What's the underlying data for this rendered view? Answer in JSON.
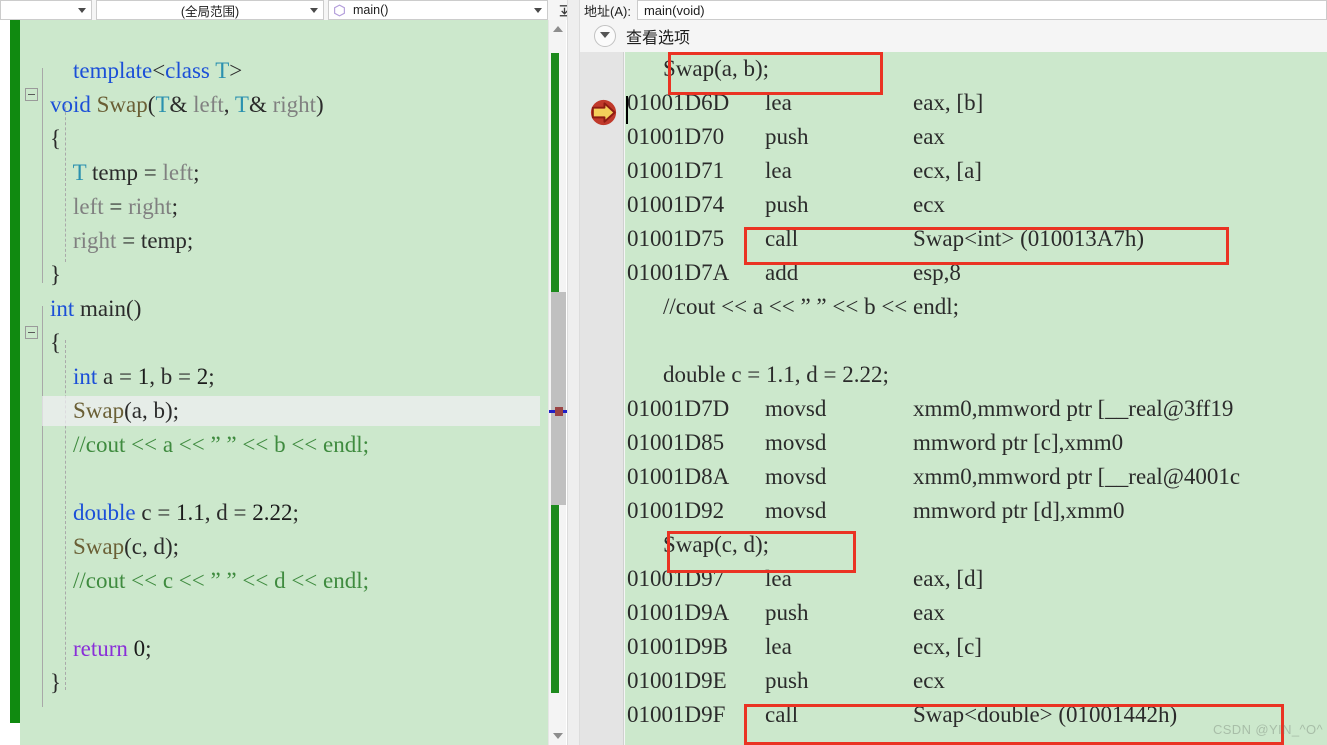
{
  "nav": {
    "scope_combo": "(全局范围)",
    "member_combo": "main()",
    "member_icon": "method-icon",
    "first_combo": "",
    "expand_button_icon": "collapse-all-icon"
  },
  "right_panel": {
    "address_label": "地址(A):",
    "address_label_plain": "地址",
    "address_accel": "A",
    "address_value": "main(void)",
    "view_options_label": "查看选项",
    "view_options_icon": "chevron-down-icon"
  },
  "editor": {
    "lines": [
      {
        "indent": 0,
        "fold": false,
        "text": "",
        "tokens": []
      },
      {
        "indent": 0,
        "fold": false,
        "tokens": [
          {
            "t": "    ",
            "c": "pln"
          },
          {
            "t": "template",
            "c": "kw"
          },
          {
            "t": "<",
            "c": "pln"
          },
          {
            "t": "class",
            "c": "kw"
          },
          {
            "t": " ",
            "c": "pln"
          },
          {
            "t": "T",
            "c": "typ"
          },
          {
            "t": ">",
            "c": "pln"
          }
        ]
      },
      {
        "indent": 0,
        "fold": true,
        "tokens": [
          {
            "t": "void",
            "c": "kw"
          },
          {
            "t": " ",
            "c": "pln"
          },
          {
            "t": "Swap",
            "c": "fn"
          },
          {
            "t": "(",
            "c": "pln"
          },
          {
            "t": "T",
            "c": "typ"
          },
          {
            "t": "& ",
            "c": "pln"
          },
          {
            "t": "left",
            "c": "gry"
          },
          {
            "t": ", ",
            "c": "pln"
          },
          {
            "t": "T",
            "c": "typ"
          },
          {
            "t": "& ",
            "c": "pln"
          },
          {
            "t": "right",
            "c": "gry"
          },
          {
            "t": ")",
            "c": "pln"
          }
        ]
      },
      {
        "indent": 0,
        "fold": false,
        "tokens": [
          {
            "t": "{",
            "c": "pln"
          }
        ]
      },
      {
        "indent": 0,
        "fold": false,
        "tokens": [
          {
            "t": "    ",
            "c": "pln"
          },
          {
            "t": "T",
            "c": "typ"
          },
          {
            "t": " temp ",
            "c": "pln"
          },
          {
            "t": "= ",
            "c": "pln"
          },
          {
            "t": "left",
            "c": "gry"
          },
          {
            "t": ";",
            "c": "pln"
          }
        ]
      },
      {
        "indent": 0,
        "fold": false,
        "tokens": [
          {
            "t": "    ",
            "c": "pln"
          },
          {
            "t": "left",
            "c": "gry"
          },
          {
            "t": " = ",
            "c": "pln"
          },
          {
            "t": "right",
            "c": "gry"
          },
          {
            "t": ";",
            "c": "pln"
          }
        ]
      },
      {
        "indent": 0,
        "fold": false,
        "tokens": [
          {
            "t": "    ",
            "c": "pln"
          },
          {
            "t": "right",
            "c": "gry"
          },
          {
            "t": " = temp;",
            "c": "pln"
          }
        ]
      },
      {
        "indent": 0,
        "fold": false,
        "tokens": [
          {
            "t": "}",
            "c": "pln"
          }
        ]
      },
      {
        "indent": 0,
        "fold": true,
        "tokens": [
          {
            "t": "int",
            "c": "kw"
          },
          {
            "t": " ",
            "c": "pln"
          },
          {
            "t": "main",
            "c": "pln"
          },
          {
            "t": "()",
            "c": "pln"
          }
        ]
      },
      {
        "indent": 0,
        "fold": false,
        "tokens": [
          {
            "t": "{",
            "c": "pln"
          }
        ]
      },
      {
        "indent": 0,
        "fold": false,
        "tokens": [
          {
            "t": "    ",
            "c": "pln"
          },
          {
            "t": "int",
            "c": "kw"
          },
          {
            "t": " a = ",
            "c": "pln"
          },
          {
            "t": "1",
            "c": "num"
          },
          {
            "t": ", b = ",
            "c": "pln"
          },
          {
            "t": "2",
            "c": "num"
          },
          {
            "t": ";",
            "c": "pln"
          }
        ]
      },
      {
        "indent": 0,
        "fold": false,
        "highlight": true,
        "tokens": [
          {
            "t": "    ",
            "c": "pln"
          },
          {
            "t": "Swap",
            "c": "fn"
          },
          {
            "t": "(a, b);",
            "c": "pln"
          }
        ]
      },
      {
        "indent": 0,
        "fold": false,
        "tokens": [
          {
            "t": "    ",
            "c": "pln"
          },
          {
            "t": "//cout << a << ” ” << b << endl;",
            "c": "com"
          }
        ]
      },
      {
        "indent": 0,
        "fold": false,
        "tokens": []
      },
      {
        "indent": 0,
        "fold": false,
        "tokens": [
          {
            "t": "    ",
            "c": "pln"
          },
          {
            "t": "double",
            "c": "kw"
          },
          {
            "t": " c = ",
            "c": "pln"
          },
          {
            "t": "1.1",
            "c": "num"
          },
          {
            "t": ", d = ",
            "c": "pln"
          },
          {
            "t": "2.22",
            "c": "num"
          },
          {
            "t": ";",
            "c": "pln"
          }
        ]
      },
      {
        "indent": 0,
        "fold": false,
        "tokens": [
          {
            "t": "    ",
            "c": "pln"
          },
          {
            "t": "Swap",
            "c": "fn"
          },
          {
            "t": "(c, d);",
            "c": "pln"
          }
        ]
      },
      {
        "indent": 0,
        "fold": false,
        "tokens": [
          {
            "t": "    ",
            "c": "pln"
          },
          {
            "t": "//cout << c << ” ” << d << endl;",
            "c": "com"
          }
        ]
      },
      {
        "indent": 0,
        "fold": false,
        "tokens": []
      },
      {
        "indent": 0,
        "fold": false,
        "tokens": [
          {
            "t": "    ",
            "c": "pln"
          },
          {
            "t": "return",
            "c": "pur"
          },
          {
            "t": " ",
            "c": "pln"
          },
          {
            "t": "0",
            "c": "num"
          },
          {
            "t": ";",
            "c": "pln"
          }
        ]
      },
      {
        "indent": 0,
        "fold": false,
        "tokens": [
          {
            "t": "}",
            "c": "pln"
          }
        ]
      }
    ]
  },
  "disassembly": {
    "lines": [
      {
        "kind": "source",
        "text": "Swap(a, b);"
      },
      {
        "kind": "asm",
        "address": "01001D6D",
        "mnemonic": "lea",
        "operands": "eax, [b]",
        "current": true
      },
      {
        "kind": "asm",
        "address": "01001D70",
        "mnemonic": "push",
        "operands": "eax"
      },
      {
        "kind": "asm",
        "address": "01001D71",
        "mnemonic": "lea",
        "operands": "ecx, [a]"
      },
      {
        "kind": "asm",
        "address": "01001D74",
        "mnemonic": "push",
        "operands": "ecx"
      },
      {
        "kind": "asm",
        "address": "01001D75",
        "mnemonic": "call",
        "operands": "Swap<int> (010013A7h)"
      },
      {
        "kind": "asm",
        "address": "01001D7A",
        "mnemonic": "add",
        "operands": "esp,8"
      },
      {
        "kind": "source",
        "text": "//cout << a << ” ” << b << endl;"
      },
      {
        "kind": "blank",
        "text": ""
      },
      {
        "kind": "source",
        "text": "double c = 1.1, d = 2.22;"
      },
      {
        "kind": "asm",
        "address": "01001D7D",
        "mnemonic": "movsd",
        "operands": "xmm0,mmword ptr [__real@3ff19"
      },
      {
        "kind": "asm",
        "address": "01001D85",
        "mnemonic": "movsd",
        "operands": "mmword ptr [c],xmm0"
      },
      {
        "kind": "asm",
        "address": "01001D8A",
        "mnemonic": "movsd",
        "operands": "xmm0,mmword ptr [__real@4001c"
      },
      {
        "kind": "asm",
        "address": "01001D92",
        "mnemonic": "movsd",
        "operands": "mmword ptr [d],xmm0"
      },
      {
        "kind": "source",
        "text": "Swap(c, d);"
      },
      {
        "kind": "asm",
        "address": "01001D97",
        "mnemonic": "lea",
        "operands": "eax, [d]"
      },
      {
        "kind": "asm",
        "address": "01001D9A",
        "mnemonic": "push",
        "operands": "eax"
      },
      {
        "kind": "asm",
        "address": "01001D9B",
        "mnemonic": "lea",
        "operands": "ecx, [c]"
      },
      {
        "kind": "asm",
        "address": "01001D9E",
        "mnemonic": "push",
        "operands": "ecx"
      },
      {
        "kind": "asm",
        "address": "01001D9F",
        "mnemonic": "call",
        "operands": "Swap<double> (01001442h)"
      }
    ],
    "current_statement_icon": "yellow-arrow-icon"
  },
  "annotations": {
    "boxes": [
      {
        "name": "swap-ab-source-box"
      },
      {
        "name": "call-swap-int-box"
      },
      {
        "name": "swap-cd-source-box"
      },
      {
        "name": "call-swap-double-box"
      }
    ],
    "color": "#ea3323"
  },
  "watermark": "CSDN @YIN_^O^",
  "colors": {
    "code_background": "#cce8cc",
    "change_bar": "#108a10",
    "annotation_red": "#ea3323",
    "keyword_blue": "#1b4fd8",
    "type_teal": "#2b91af",
    "comment_green": "#3f8b3f",
    "return_purple": "#8a2fd8"
  }
}
